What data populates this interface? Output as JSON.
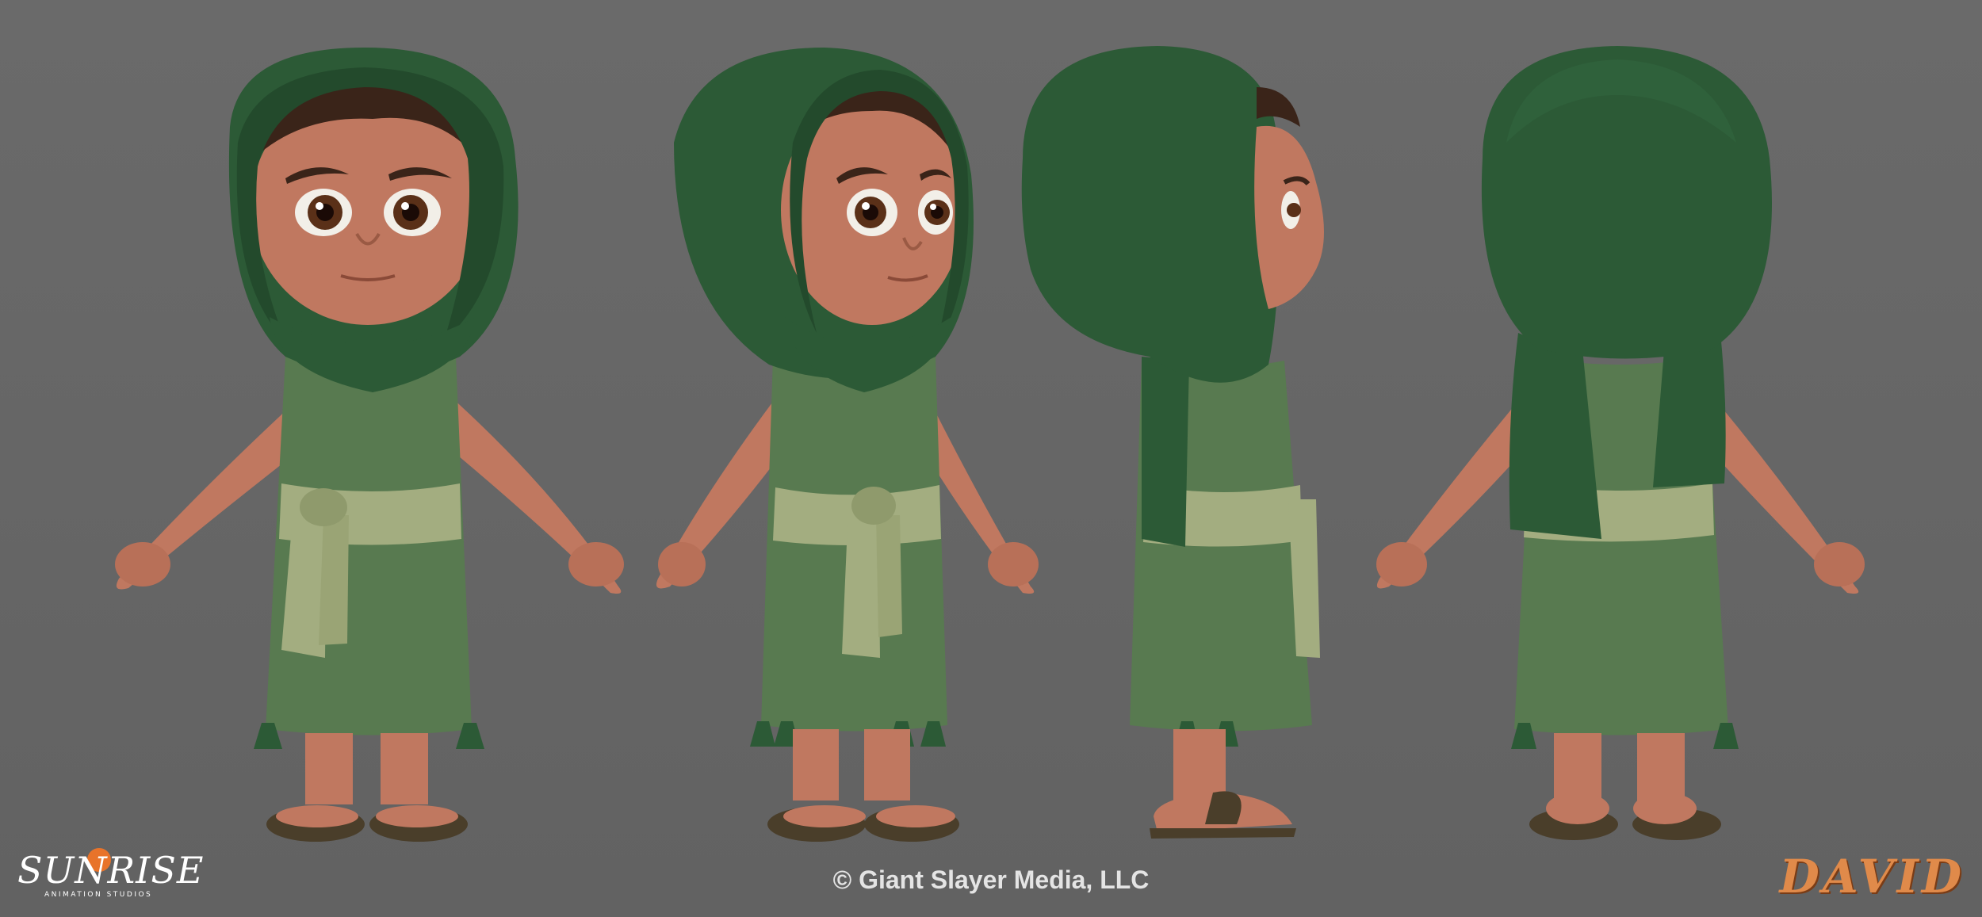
{
  "studio_logo": {
    "word": "SUNRISE",
    "subtitle": "ANIMATION STUDIOS"
  },
  "copyright": "© Giant Slayer Media, LLC",
  "title_logo": "DAVID",
  "colors": {
    "background": "#696969",
    "hood": "#2c5a36",
    "tunic": "#587a50",
    "sash": "#a3ad80",
    "skin": "#c07860",
    "hair": "#3a2419",
    "sandal": "#4a3e2a"
  }
}
